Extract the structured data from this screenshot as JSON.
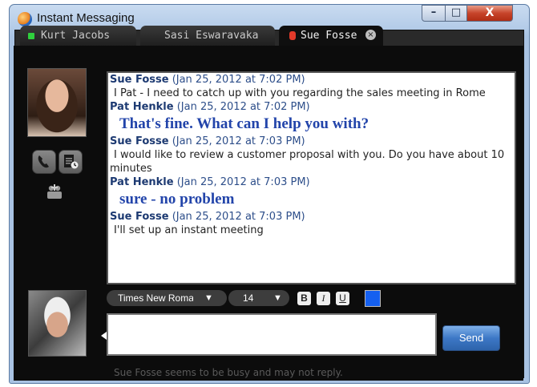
{
  "window": {
    "title": "Instant Messaging",
    "controls": {
      "minimize": "–",
      "maximize": "□",
      "close": "X"
    }
  },
  "tabs": [
    {
      "label": "Kurt Jacobs",
      "status_color": "#2fcf3d",
      "active": false
    },
    {
      "label": "Sasi Eswaravaka",
      "status_color": "",
      "active": false
    },
    {
      "label": "Sue Fosse",
      "status_color": "#e23a2a",
      "active": true,
      "close_glyph": "×"
    }
  ],
  "contact_panel": {
    "icons": [
      "phone-icon",
      "notes-icon",
      "add-contact-icon"
    ]
  },
  "messages": [
    {
      "sender": "Sue Fosse",
      "timestamp": "(Jan 25, 2012 at 7:02 PM)",
      "text": "I Pat - I need to catch up with you regarding the sales meeting in Rome",
      "style": "normal"
    },
    {
      "sender": "Pat Henkle",
      "timestamp": "(Jan 25, 2012 at 7:02 PM)",
      "text": "That's fine.  What can I help you with?",
      "style": "large"
    },
    {
      "sender": "Sue Fosse",
      "timestamp": "(Jan 25, 2012 at 7:03 PM)",
      "text": "I would like to review a customer proposal with you.  Do you have about 10 minutes",
      "style": "normal"
    },
    {
      "sender": "Pat Henkle",
      "timestamp": "(Jan 25, 2012 at 7:03 PM)",
      "text": "sure - no problem",
      "style": "large"
    },
    {
      "sender": "Sue Fosse",
      "timestamp": "(Jan 25, 2012 at 7:03 PM)",
      "text": "I'll set up an instant meeting",
      "style": "normal"
    }
  ],
  "toolbar": {
    "font_family": "Times New Roman",
    "font_size": "14",
    "caret": "▼",
    "bold_label": "B",
    "italic_label": "I",
    "underline_label": "U",
    "text_color": "#1560f0"
  },
  "compose": {
    "value": ""
  },
  "send_label": "Send",
  "status_message": "Sue Fosse seems to be busy and may not reply."
}
